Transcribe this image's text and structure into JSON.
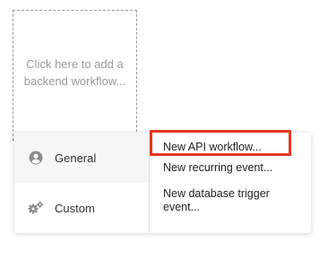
{
  "add_zone": {
    "text": "Click here to add a\nbackend workflow..."
  },
  "menu": {
    "categories": [
      {
        "label": "General",
        "icon": "user-circle-icon",
        "active": true
      },
      {
        "label": "Custom",
        "icon": "gears-icon",
        "active": false
      }
    ],
    "options": [
      {
        "label": "New API workflow..."
      },
      {
        "label": "New recurring event..."
      },
      {
        "label": "New database trigger\nevent..."
      }
    ]
  },
  "colors": {
    "highlight": "#e8361c",
    "muted_text": "#9a9a9a",
    "active_bg": "#f6f6f6"
  }
}
